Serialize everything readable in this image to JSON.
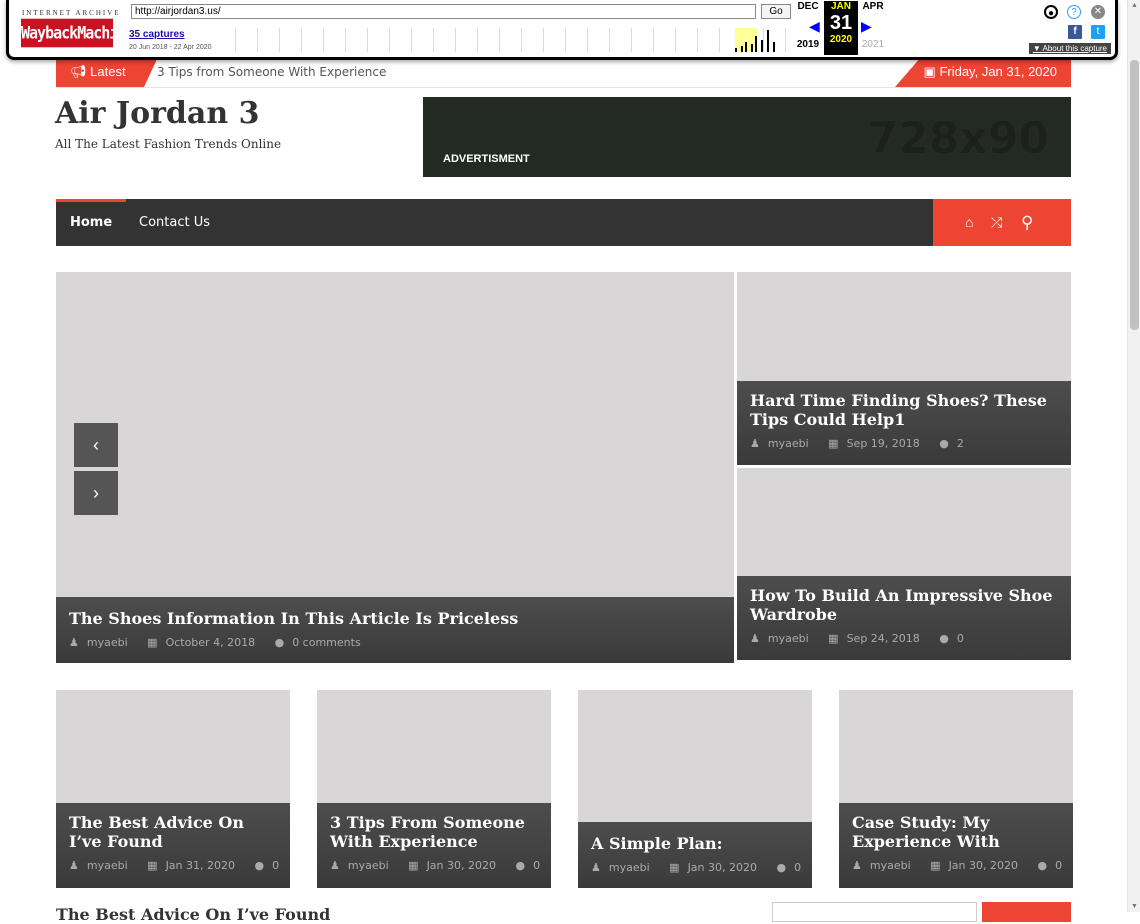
{
  "wayback": {
    "logo_top": "INTERNET ARCHIVE",
    "logo_main": "WaybackMachine",
    "url": "http://airjordan3.us/",
    "go_label": "Go",
    "captures": "35 captures",
    "range": "20 Jun 2018 - 22 Apr 2020",
    "prev_month": "DEC",
    "cur_month": "JAN",
    "next_month": "APR",
    "prev_year": "2019",
    "cur_day": "31",
    "cur_year": "2020",
    "next_year": "2021",
    "about": "About this capture"
  },
  "topbar": {
    "latest_label": "Latest",
    "latest_text": "3 Tips from Someone With Experience",
    "date": "Friday, Jan 31, 2020"
  },
  "site": {
    "title": "Air Jordan 3",
    "description": "All The Latest Fashion Trends Online"
  },
  "ad": {
    "label": "ADVERTISMENT",
    "size": "728x90"
  },
  "nav": {
    "home": "Home",
    "contact": "Contact Us"
  },
  "slider": {
    "main": {
      "title": "The Shoes Information In This Article Is Priceless",
      "author": "myaebi",
      "date": "October 4, 2018",
      "comments": "0 comments"
    },
    "side": [
      {
        "title": "Hard Time Finding Shoes? These Tips Could Help1",
        "author": "myaebi",
        "date": "Sep 19, 2018",
        "comments": "2"
      },
      {
        "title": "How To Build An Impressive Shoe Wardrobe",
        "author": "myaebi",
        "date": "Sep 24, 2018",
        "comments": "0"
      }
    ]
  },
  "cards": [
    {
      "title": "The Best Advice On I’ve Found",
      "author": "myaebi",
      "date": "Jan 31, 2020",
      "comments": "0"
    },
    {
      "title": "3 Tips From Someone With Experience",
      "author": "myaebi",
      "date": "Jan 30, 2020",
      "comments": "0"
    },
    {
      "title": "A Simple Plan:",
      "author": "myaebi",
      "date": "Jan 30, 2020",
      "comments": "0"
    },
    {
      "title": "Case Study: My Experience With",
      "author": "myaebi",
      "date": "Jan 30, 2020",
      "comments": "0"
    }
  ],
  "bottom": {
    "heading": "The Best Advice On I’ve Found"
  },
  "colors": {
    "accent": "#ee4433",
    "nav_bg": "#333333",
    "ad_bg": "#232a24"
  }
}
